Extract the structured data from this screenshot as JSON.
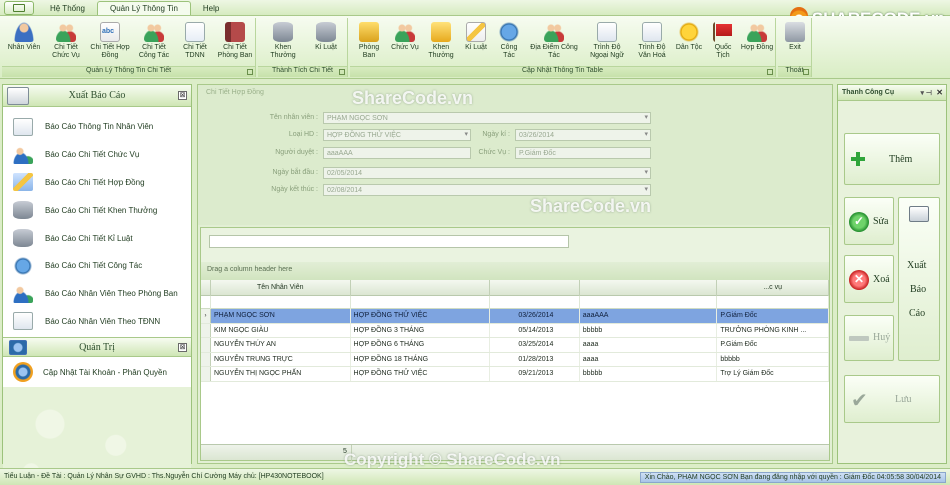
{
  "tabs": [
    "Hệ Thống",
    "Quản Lý Thông Tin",
    "Help"
  ],
  "ribbon": {
    "groups": [
      {
        "label": "Quản Lý Thông Tin Chi Tiết",
        "buttons": [
          {
            "label": "Nhân Viên",
            "icon": "person-icon"
          },
          {
            "label": "Chi Tiết Chức Vụ",
            "icon": "people-icon"
          },
          {
            "label": "Chi Tiết Hợp Đồng",
            "icon": "abc-icon"
          },
          {
            "label": "Chi Tiết Công Tác",
            "icon": "people-icon"
          },
          {
            "label": "Chi Tiết TDNN",
            "icon": "doc-icon"
          },
          {
            "label": "Chi Tiết Phòng Ban",
            "icon": "book-icon"
          }
        ]
      },
      {
        "label": "Thành Tích Chi Tiết",
        "buttons": [
          {
            "label": "Khen Thưởng",
            "icon": "database-icon"
          },
          {
            "label": "Kỉ Luật",
            "icon": "database-icon"
          }
        ]
      },
      {
        "label": "Cập Nhật Thông Tin Table",
        "buttons": [
          {
            "label": "Phòng Ban",
            "icon": "folder-icon"
          },
          {
            "label": "Chức Vụ",
            "icon": "people-icon"
          },
          {
            "label": "Khen Thưởng",
            "icon": "money-icon"
          },
          {
            "label": "Kỉ Luật",
            "icon": "pencil-icon"
          },
          {
            "label": "Công Tác",
            "icon": "globe-icon"
          },
          {
            "label": "Địa Điểm Công Tác",
            "icon": "people-icon"
          },
          {
            "label": "Trình Độ Ngoại Ngữ",
            "icon": "note-icon"
          },
          {
            "label": "Trình Độ Văn Hoá",
            "icon": "note-icon"
          },
          {
            "label": "Dân Tộc",
            "icon": "star-icon"
          },
          {
            "label": "Quốc Tịch",
            "icon": "flag-icon"
          },
          {
            "label": "Hợp Đồng",
            "icon": "people-icon"
          }
        ]
      },
      {
        "label": "Thoát",
        "buttons": [
          {
            "label": "Exit",
            "icon": "exit-icon"
          }
        ]
      }
    ]
  },
  "left_panel": {
    "title": "Xuất Báo Cáo",
    "items": [
      "Báo Cáo Thông Tin Nhân Viên",
      "Báo Cáo Chi Tiết Chức Vụ",
      "Báo Cáo Chi Tiết Hợp Đồng",
      "Báo Cáo  Chi Tiết Khen Thưởng",
      "Báo Cáo Chi Tiết Kỉ Luật",
      "Báo Cáo Chi Tiết Công Tác",
      "Báo Cáo Nhân Viên Theo Phòng Ban",
      "Báo Cáo Nhân Viên Theo TĐNN"
    ],
    "admin_title": "Quản Trị",
    "admin_item": "Cập Nhật Tài Khoản - Phân Quyền"
  },
  "form": {
    "title": "Chi Tiết Hợp Đồng",
    "employee_label": "Tên nhân viên :",
    "employee_value": "PHẠM NGỌC SƠN",
    "contract_type_label": "Loại HD :",
    "contract_type_value": "HỢP ĐỒNG THỬ VIỆC",
    "sign_date_label": "Ngày kí :",
    "sign_date_value": "03/26/2014",
    "approver_label": "Người duyệt :",
    "approver_value": "aaaAAA",
    "position_label": "Chức Vụ :",
    "position_value": "P.Giám Đốc",
    "start_label": "Ngày bắt đầu :",
    "start_value": "02/05/2014",
    "end_label": "Ngày kết thúc :",
    "end_value": "02/08/2014"
  },
  "grid": {
    "group_hint": "Drag a column header here",
    "columns": [
      "Tên Nhân Viên",
      "",
      "",
      "",
      "...c vụ",
      ""
    ],
    "rows": [
      [
        "PHẠM NGỌC SƠN",
        "HỢP ĐỒNG THỬ VIỆC",
        "03/26/2014",
        "aaaAAA",
        "P.Giám Đốc"
      ],
      [
        "KIM NGỌC GIÀU",
        "HỢP ĐỒNG 3 THÁNG",
        "05/14/2013",
        "bbbbb",
        "TRƯỞNG PHÒNG KINH ..."
      ],
      [
        "NGUYỄN THÚY AN",
        "HỢP ĐỒNG 6 THÁNG",
        "03/25/2014",
        "aaaa",
        "P.Giám Đốc"
      ],
      [
        "NGUYỄN TRUNG TRỰC",
        "HỢP ĐỒNG 18 THÁNG",
        "01/28/2013",
        "aaaa",
        "bbbbb"
      ],
      [
        "NGUYỄN THỊ NGỌC PHẤN",
        "HỢP ĐỒNG THỬ VIỆC",
        "09/21/2013",
        "bbbbb",
        "Trợ Lý Giám Đốc"
      ]
    ],
    "selected_row": 0,
    "count": "5"
  },
  "toolbox": {
    "title": "Thanh Công Cụ",
    "pin": "▾ ⊣",
    "close": "✕",
    "add": "Thêm",
    "edit": "Sửa",
    "delete": "Xoá",
    "cancel": "Huỷ",
    "save": "Lưu",
    "export": [
      "Xuất",
      "Báo",
      "Cáo"
    ]
  },
  "status": {
    "left": "Tiểu Luận - Đề Tài : Quản Lý Nhân Sự  GVHD : Ths.Nguyễn Chí Cường  Máy chủ: [HP430NOTEBOOK]",
    "right": "Xin Chào,  PHẠM NGỌC SƠN  Bạn đang đăng nhập với quyền : Giám Đốc   04:05:58 30/04/2014"
  },
  "watermarks": {
    "logo": "SHARECODE.vn",
    "top": "ShareCode.vn",
    "middle": "ShareCode.vn",
    "bottom": "Copyright © ShareCode.vn"
  },
  "colors": {
    "ribbon_bg": "#d9edc4",
    "selected_row": "#7ea4e0",
    "accent_green": "#2fa53a",
    "delete_red": "#c41c1c"
  }
}
